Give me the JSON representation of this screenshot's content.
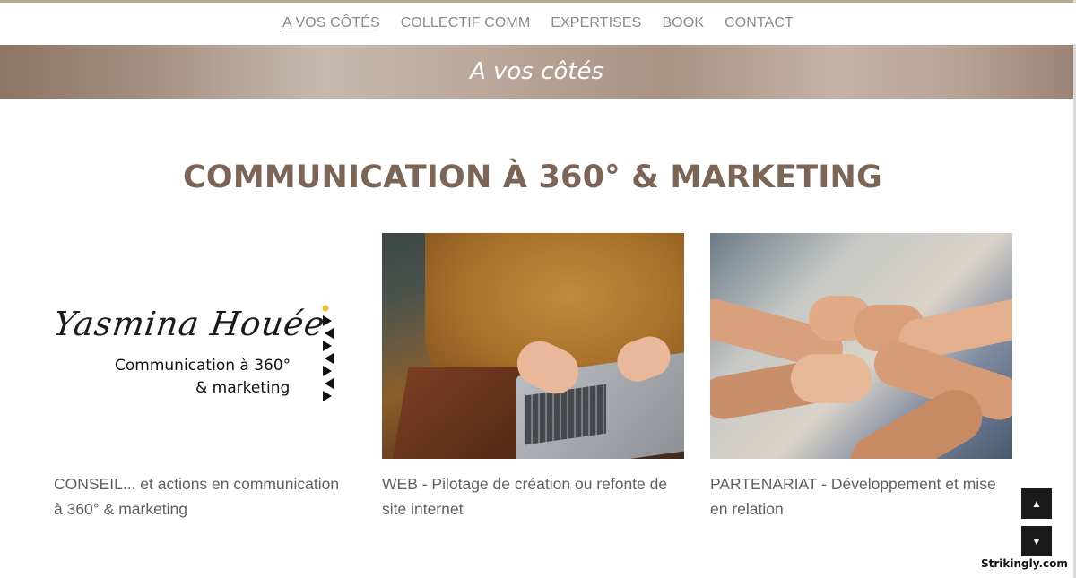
{
  "nav": {
    "items": [
      {
        "label": "A VOS CÔTÉS",
        "active": true
      },
      {
        "label": "COLLECTIF COMM",
        "active": false
      },
      {
        "label": "EXPERTISES",
        "active": false
      },
      {
        "label": "BOOK",
        "active": false
      },
      {
        "label": "CONTACT",
        "active": false
      }
    ]
  },
  "banner": {
    "title": "A vos côtés"
  },
  "section": {
    "title": "COMMUNICATION À 360° & MARKETING"
  },
  "cards": [
    {
      "image": "yasmina-houee-logo",
      "logo": {
        "script": "Yasmina Houée",
        "line1": "Communication à 360°",
        "line2": "& marketing"
      },
      "caption_line1": "CONSEIL... et actions en communication",
      "caption_line2": "à 360° & marketing"
    },
    {
      "image": "laptop-typing-photo",
      "caption_line1": "WEB - Pilotage de création ou refonte de",
      "caption_line2": "site internet"
    },
    {
      "image": "team-fists-together-photo",
      "caption_line1": "PARTENARIAT - Développement et mise",
      "caption_line2": "en relation"
    }
  ],
  "controls": {
    "scroll_up": "▲",
    "scroll_down": "▼"
  },
  "footer": {
    "brand": "Strikingly.com"
  },
  "colors": {
    "banner": "#a89385",
    "title": "#7a6556",
    "nav_text": "#8a8a8a",
    "accent_line": "#b8aa8c"
  }
}
